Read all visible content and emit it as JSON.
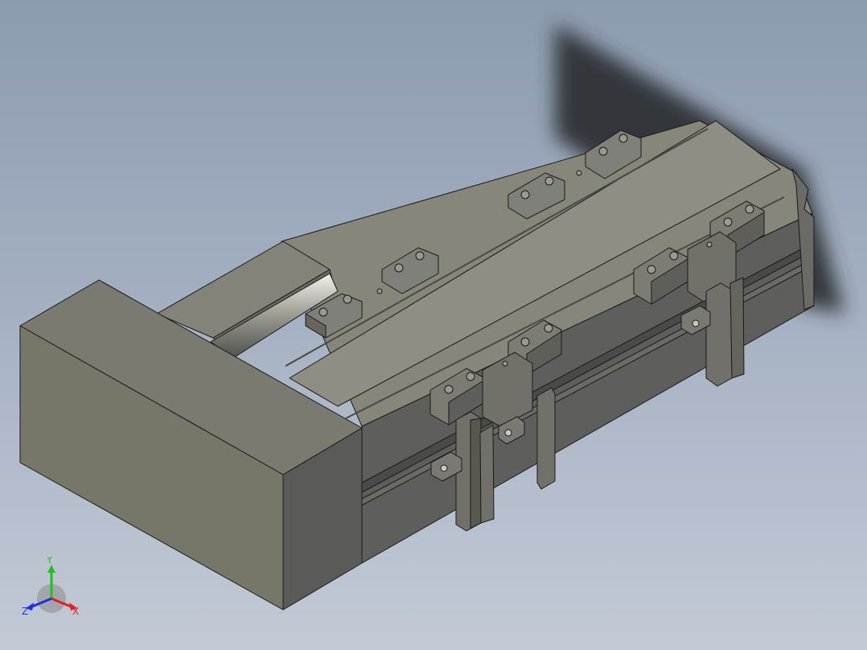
{
  "viewport": {
    "background_top": "#8d9bb0",
    "background_bottom": "#c3cad6"
  },
  "model": {
    "face_light": "#8a8a7e",
    "face_top": "#7e7e72",
    "face_front": "#737366",
    "face_dark": "#585858",
    "shadow": "#2e3336",
    "edge": "#1a1a1a"
  },
  "triad": {
    "x_label": "X",
    "y_label": "Y",
    "z_label": "Z",
    "x_color": "#e02020",
    "y_color": "#20c020",
    "z_color": "#2030e0"
  }
}
